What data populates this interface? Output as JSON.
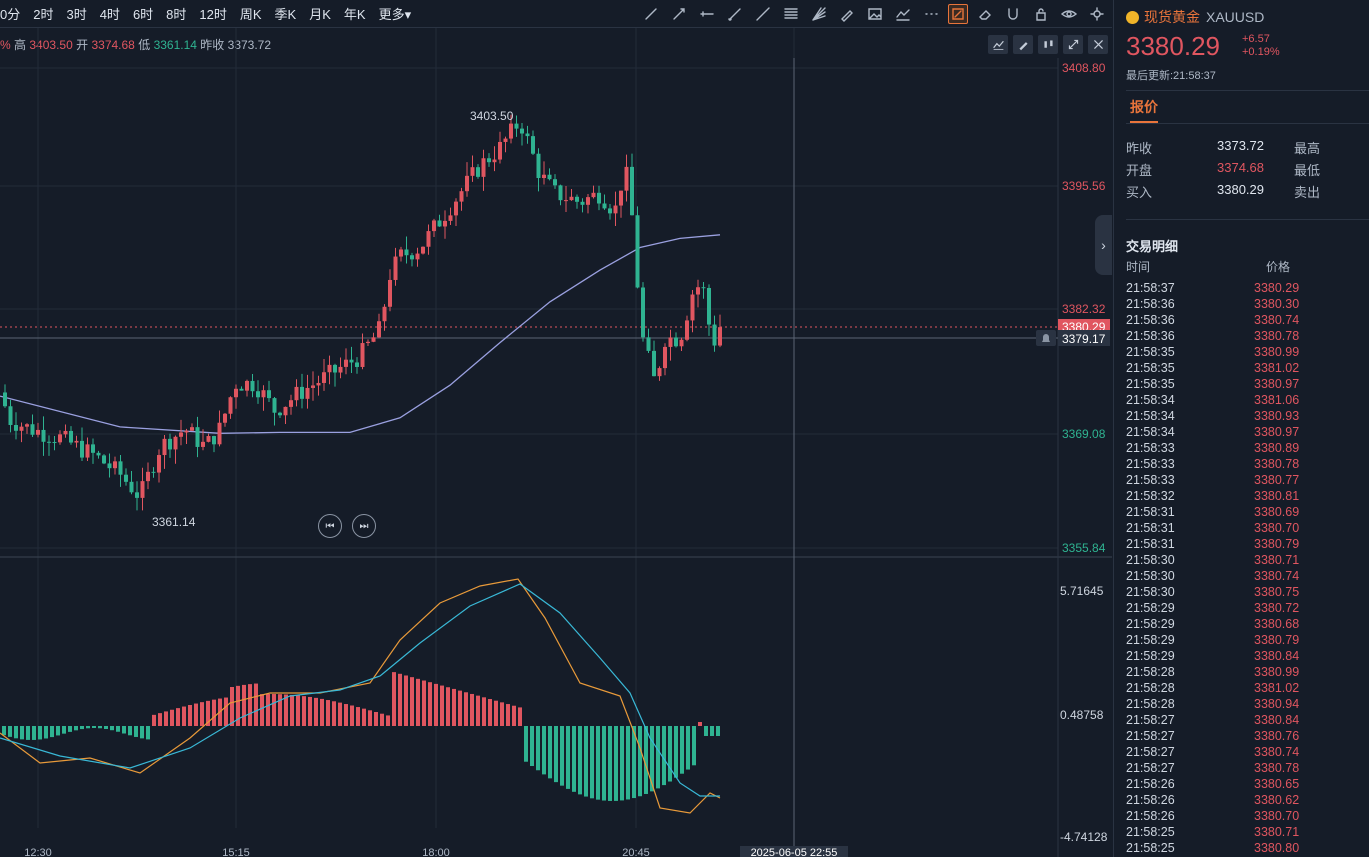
{
  "toolbar": {
    "periods": [
      "0分",
      "2时",
      "3时",
      "4时",
      "6时",
      "8时",
      "12时",
      "周K",
      "季K",
      "月K",
      "年K",
      "更多▾"
    ],
    "drawing_tools": [
      "line-icon",
      "ray-icon",
      "horizontal-line-icon",
      "segment-icon",
      "extended-line-icon",
      "fibonacci-icon",
      "fan-icon",
      "pencil-icon",
      "image-icon",
      "trend-icon",
      "more-dots-icon",
      "draw-mode-icon",
      "eraser-icon",
      "magnet-icon",
      "lock-icon",
      "eye-icon",
      "settings-icon"
    ]
  },
  "ohlc_bar": {
    "lead": "%",
    "high_label": "高",
    "high": "3403.50",
    "open_label": "开",
    "open": "3374.68",
    "low_label": "低",
    "low": "3361.14",
    "prev_label": "昨收",
    "prev": "3373.72"
  },
  "chart_data": {
    "type": "candlestick",
    "price_axis_labels": [
      "3408.80",
      "3395.56",
      "3382.32",
      "3369.08",
      "3355.84"
    ],
    "price_axis_range": [
      3355.84,
      3408.8
    ],
    "current_price_tag": "3380.29",
    "crosshair_price_tag": "3379.17",
    "annotations": {
      "high": "3403.50",
      "low": "3361.14"
    },
    "macd_axis_labels": [
      "5.71645",
      "0.48758",
      "-4.74128"
    ],
    "time_axis_labels": [
      "12:30",
      "15:15",
      "18:00",
      "20:45"
    ],
    "crosshair_time": "2025-06-05 22:55",
    "colors": {
      "up": "#e05660",
      "down": "#2fb391",
      "ma": "#9aa0e0",
      "dif": "#e89a3a",
      "dea": "#39b8d6"
    }
  },
  "panel": {
    "name": "现货黄金",
    "code": "XAUUSD",
    "price": "3380.29",
    "change": "+6.57",
    "change_pct": "+0.19%",
    "updated": "最后更新:21:58:37",
    "tab": "报价",
    "quote": {
      "prev_label": "昨收",
      "prev": "3373.72",
      "high_label": "最高",
      "open_label": "开盘",
      "open": "3374.68",
      "low_label": "最低",
      "bid_label": "买入",
      "bid": "3380.29",
      "ask_label": "卖出"
    },
    "trades_title": "交易明细",
    "trades_time_col": "时间",
    "trades_price_col": "价格",
    "trades": [
      [
        "21:58:37",
        "3380.29"
      ],
      [
        "21:58:36",
        "3380.30"
      ],
      [
        "21:58:36",
        "3380.74"
      ],
      [
        "21:58:36",
        "3380.78"
      ],
      [
        "21:58:35",
        "3380.99"
      ],
      [
        "21:58:35",
        "3381.02"
      ],
      [
        "21:58:35",
        "3380.97"
      ],
      [
        "21:58:34",
        "3381.06"
      ],
      [
        "21:58:34",
        "3380.93"
      ],
      [
        "21:58:34",
        "3380.97"
      ],
      [
        "21:58:33",
        "3380.89"
      ],
      [
        "21:58:33",
        "3380.78"
      ],
      [
        "21:58:33",
        "3380.77"
      ],
      [
        "21:58:32",
        "3380.81"
      ],
      [
        "21:58:31",
        "3380.69"
      ],
      [
        "21:58:31",
        "3380.70"
      ],
      [
        "21:58:31",
        "3380.79"
      ],
      [
        "21:58:30",
        "3380.71"
      ],
      [
        "21:58:30",
        "3380.74"
      ],
      [
        "21:58:30",
        "3380.75"
      ],
      [
        "21:58:29",
        "3380.72"
      ],
      [
        "21:58:29",
        "3380.68"
      ],
      [
        "21:58:29",
        "3380.79"
      ],
      [
        "21:58:29",
        "3380.84"
      ],
      [
        "21:58:28",
        "3380.99"
      ],
      [
        "21:58:28",
        "3381.02"
      ],
      [
        "21:58:28",
        "3380.94"
      ],
      [
        "21:58:27",
        "3380.84"
      ],
      [
        "21:58:27",
        "3380.76"
      ],
      [
        "21:58:27",
        "3380.74"
      ],
      [
        "21:58:27",
        "3380.78"
      ],
      [
        "21:58:26",
        "3380.65"
      ],
      [
        "21:58:26",
        "3380.62"
      ],
      [
        "21:58:26",
        "3380.70"
      ],
      [
        "21:58:25",
        "3380.71"
      ],
      [
        "21:58:25",
        "3380.80"
      ]
    ]
  }
}
